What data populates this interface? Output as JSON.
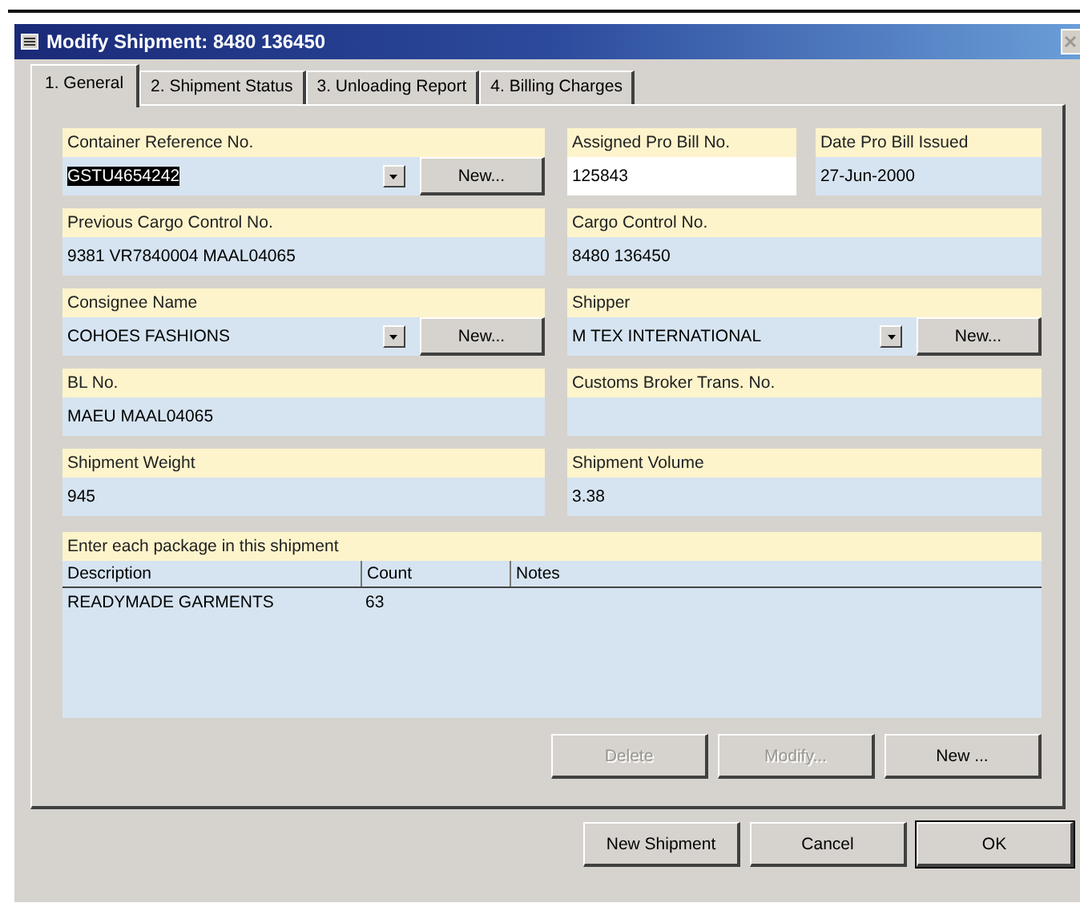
{
  "window": {
    "title": "Modify Shipment: 8480 136450"
  },
  "tabs": [
    {
      "label": "1. General",
      "selected": true
    },
    {
      "label": "2. Shipment Status",
      "selected": false
    },
    {
      "label": "3. Unloading Report",
      "selected": false
    },
    {
      "label": "4. Billing Charges",
      "selected": false
    }
  ],
  "field_rows": [
    [
      {
        "kind": "combo",
        "label": "Container Reference No.",
        "value": "GSTU4654242",
        "editable": false,
        "text_selected": true,
        "button": "New..."
      },
      {
        "kind": "text",
        "label": "Assigned Pro Bill No.",
        "value": "125843",
        "editable": true,
        "text_selected": false
      },
      {
        "kind": "text",
        "label": "Date Pro Bill Issued",
        "value": "27-Jun-2000",
        "editable": false,
        "text_selected": false
      }
    ],
    [
      {
        "kind": "text",
        "label": "Previous Cargo Control No.",
        "value": "9381 VR7840004 MAAL04065",
        "editable": false,
        "text_selected": false
      },
      {
        "kind": "text",
        "label": "Cargo Control No.",
        "value": "8480 136450",
        "editable": false,
        "text_selected": false
      }
    ],
    [
      {
        "kind": "combo",
        "label": "Consignee Name",
        "value": "COHOES FASHIONS",
        "editable": false,
        "text_selected": false,
        "button": "New..."
      },
      {
        "kind": "combo",
        "label": "Shipper",
        "value": "M TEX INTERNATIONAL",
        "editable": false,
        "text_selected": false,
        "button": "New..."
      }
    ],
    [
      {
        "kind": "text",
        "label": "BL No.",
        "value": "MAEU MAAL04065",
        "editable": false,
        "text_selected": false
      },
      {
        "kind": "text",
        "label": "Customs Broker Trans. No.",
        "editable": false
      }
    ],
    [
      {
        "kind": "text",
        "label": "Shipment Weight",
        "value": "945",
        "editable": false,
        "text_selected": false
      },
      {
        "kind": "text",
        "label": "Shipment Volume",
        "value": "3.38",
        "editable": false,
        "text_selected": false
      }
    ]
  ],
  "packages": {
    "label": "Enter each package in this shipment",
    "columns": [
      "Description",
      "Count",
      "Notes"
    ],
    "rows": [
      [
        "READYMADE GARMENTS",
        "63"
      ]
    ]
  },
  "package_buttons": [
    {
      "label": "Delete",
      "disabled": true
    },
    {
      "label": "Modify...",
      "disabled": true
    },
    {
      "label": "New ...",
      "disabled": false
    }
  ],
  "dialog_buttons": [
    {
      "label": "New Shipment",
      "default": false
    },
    {
      "label": "Cancel",
      "default": false
    },
    {
      "label": "OK",
      "default": true
    }
  ]
}
